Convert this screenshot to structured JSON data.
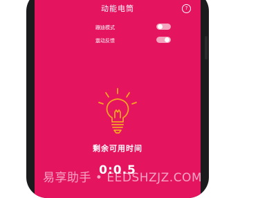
{
  "header": {
    "title": "动能电筒",
    "help_icon": "question-circle-icon"
  },
  "settings": [
    {
      "label": "蹦迪模式",
      "toggle_on": false
    },
    {
      "label": "震动反馈",
      "toggle_on": true
    }
  ],
  "bulb": {
    "icon": "lightbulb-icon",
    "color": "#f5a623"
  },
  "remaining": {
    "label": "剩余可用时间",
    "time": "0:0.5"
  },
  "watermark": "易享助手 • EEDSHZJZ.COM",
  "colors": {
    "background": "#e5145f",
    "toggle_off_knob": "#ffffff",
    "toggle_on_knob": "#ffffff",
    "toggle_track": "#f4a3bf",
    "bulb": "#f5a623"
  }
}
